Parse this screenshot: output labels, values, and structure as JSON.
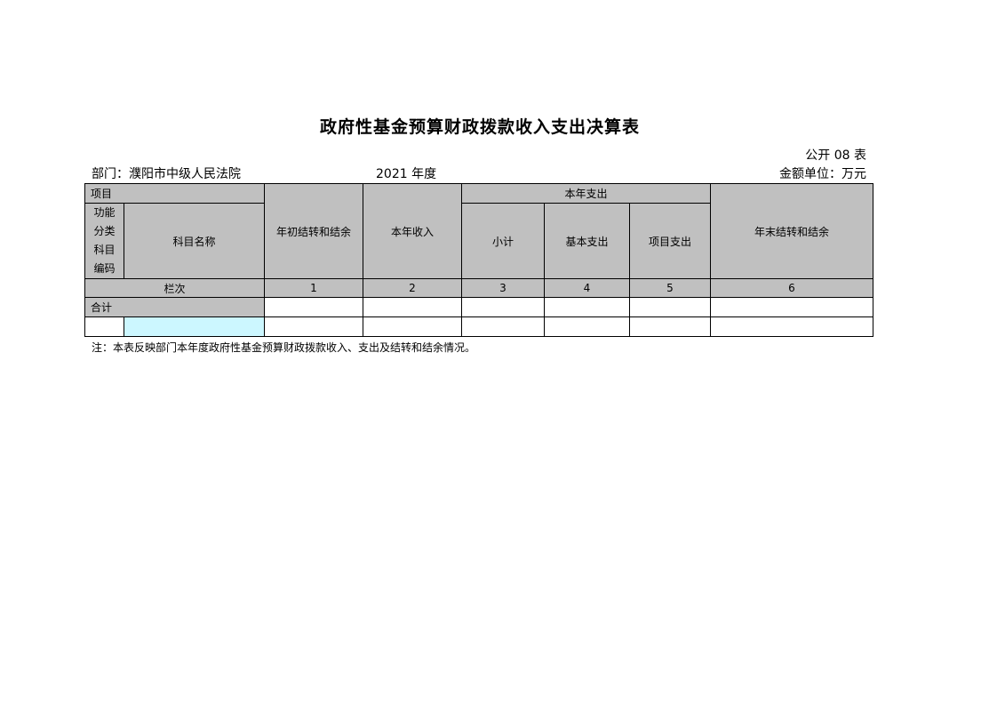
{
  "title": "政府性基金预算财政拨款收入支出决算表",
  "form_no": "公开 08 表",
  "department": "部门：濮阳市中级人民法院",
  "year": "2021 年度",
  "unit": "金额单位：万元",
  "table": {
    "project": "项目",
    "func_code_lines": [
      "功能",
      "分类",
      "科目",
      "编码"
    ],
    "subject_name": "科目名称",
    "opening_balance": "年初结转和结余",
    "current_income": "本年收入",
    "current_expense": "本年支出",
    "subtotal": "小计",
    "basic_expense": "基本支出",
    "project_expense": "项目支出",
    "closing_balance": "年末结转和结余",
    "column_index_label": "栏次",
    "column_numbers": [
      "1",
      "2",
      "3",
      "4",
      "5",
      "6"
    ],
    "total_label": "合计"
  },
  "note": "注：本表反映部门本年度政府性基金预算财政拨款收入、支出及结转和结余情况。",
  "colors": {
    "header_gray": "#c0c0c0",
    "input_cyan": "#ccf7ff"
  }
}
